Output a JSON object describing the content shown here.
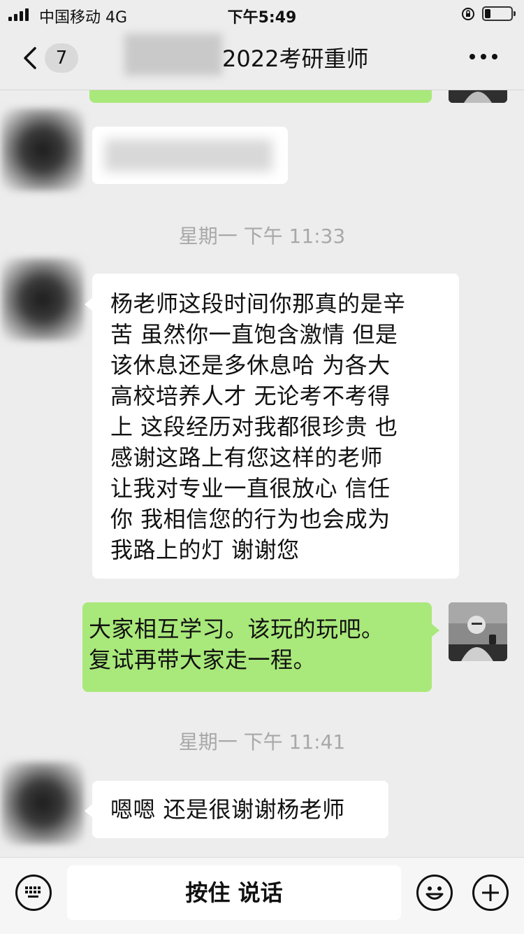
{
  "status_bar": {
    "carrier": "中国移动  4G",
    "time": "下午5:49"
  },
  "nav": {
    "back_count": "7",
    "title": "2022考研重师"
  },
  "chat": {
    "timestamp_1": "星期一 下午 11:33",
    "message_1": "杨老师这段时间你那真的是辛苦 虽然你一直饱含激情 但是该休息还是多休息哈 为各大高校培养人才 无论考不考得上 这段经历对我都很珍贵 也感谢这路上有您这样的老师 让我对专业一直很放心 信任你 我相信您的行为也会成为我路上的灯 谢谢您",
    "message_1_lines": [
      "杨老师这段时间你那真的是辛",
      "苦 虽然你一直饱含激情 但是",
      "该休息还是多休息哈 为各大",
      "高校培养人才 无论考不考得",
      "上 这段经历对我都很珍贵 也",
      "感谢这路上有您这样的老师",
      "让我对专业一直很放心 信任",
      "你 我相信您的行为也会成为",
      "我路上的灯 谢谢您"
    ],
    "reply_lines": [
      "大家相互学习。该玩的玩吧。",
      "复试再带大家走一程。"
    ],
    "timestamp_2": "星期一 下午 11:41",
    "message_2": "嗯嗯 还是很谢谢杨老师"
  },
  "input_bar": {
    "voice_label": "按住 说话",
    "left_icon": "keyboard-icon",
    "emoji_icon": "emoji-icon",
    "plus_icon": "plus-icon"
  },
  "colors": {
    "background": "#ededed",
    "sent_bubble": "#a9e87a",
    "received_bubble": "#ffffff",
    "timestamp": "#a8a8a8"
  }
}
